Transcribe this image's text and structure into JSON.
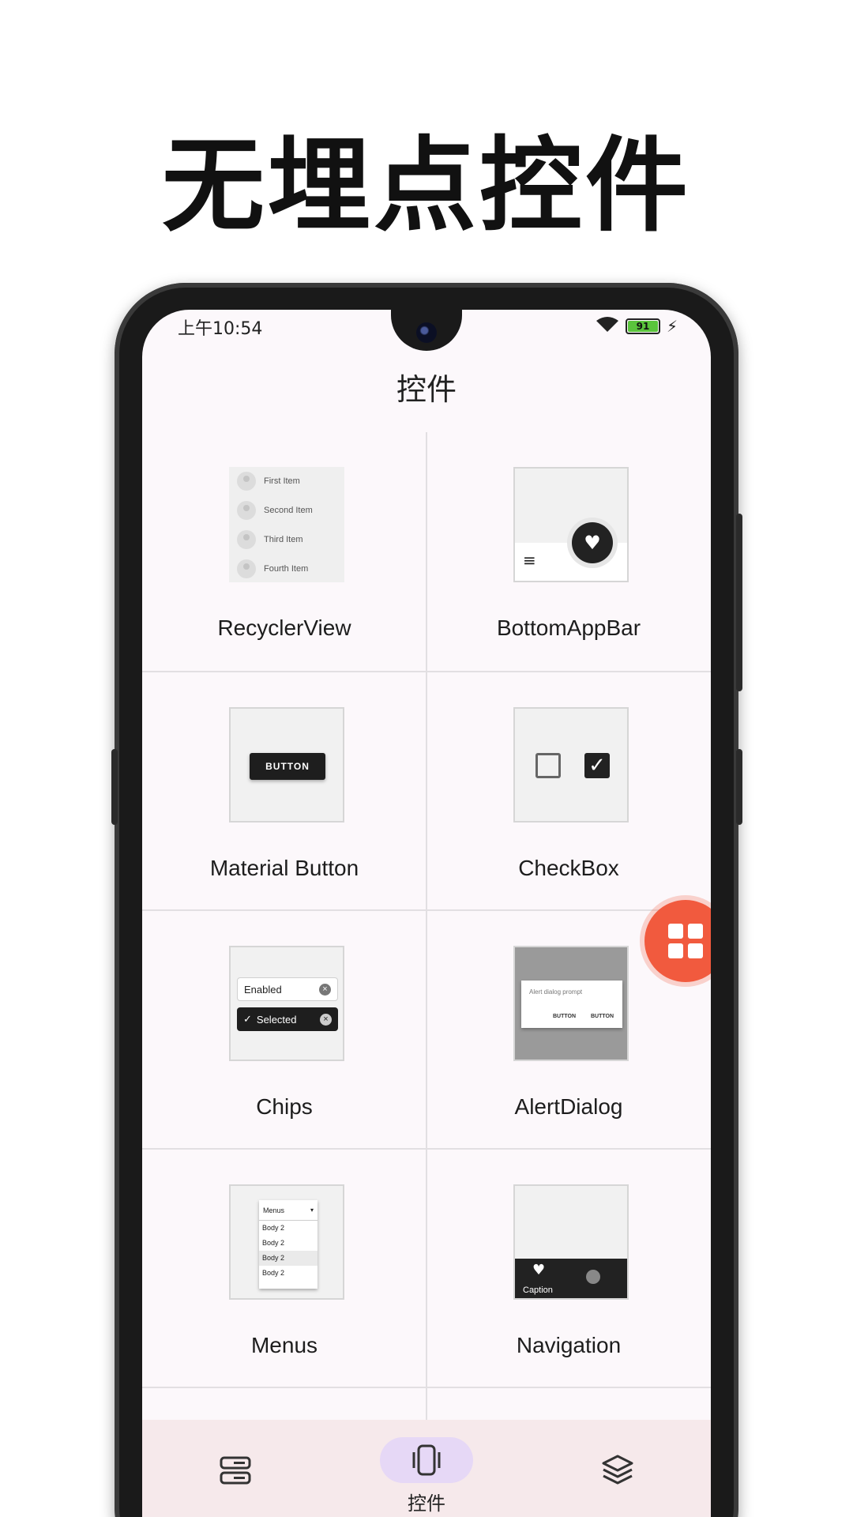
{
  "headline": "无埋点控件",
  "status": {
    "time": "上午10:54",
    "battery": "91"
  },
  "app_title": "控件",
  "items": [
    {
      "label": "RecyclerView",
      "rows": [
        "First Item",
        "Second Item",
        "Third Item",
        "Fourth Item"
      ]
    },
    {
      "label": "BottomAppBar"
    },
    {
      "label": "Material Button",
      "button_text": "BUTTON"
    },
    {
      "label": "CheckBox"
    },
    {
      "label": "Chips",
      "chip_enabled": "Enabled",
      "chip_selected": "Selected"
    },
    {
      "label": "AlertDialog",
      "prompt": "Alert dialog prompt",
      "button1": "BUTTON",
      "button2": "BUTTON"
    },
    {
      "label": "Menus",
      "menu_header": "Menus",
      "menu_items": [
        "Body 2",
        "Body 2",
        "Body 2",
        "Body 2"
      ]
    },
    {
      "label": "Navigation",
      "caption": "Caption"
    }
  ],
  "bottom_nav": {
    "active_label": "控件"
  },
  "colors": {
    "fab": "#f15a3e",
    "nav_pill": "#e6d8f6",
    "bottom_nav_bg": "#f6e9eb"
  }
}
